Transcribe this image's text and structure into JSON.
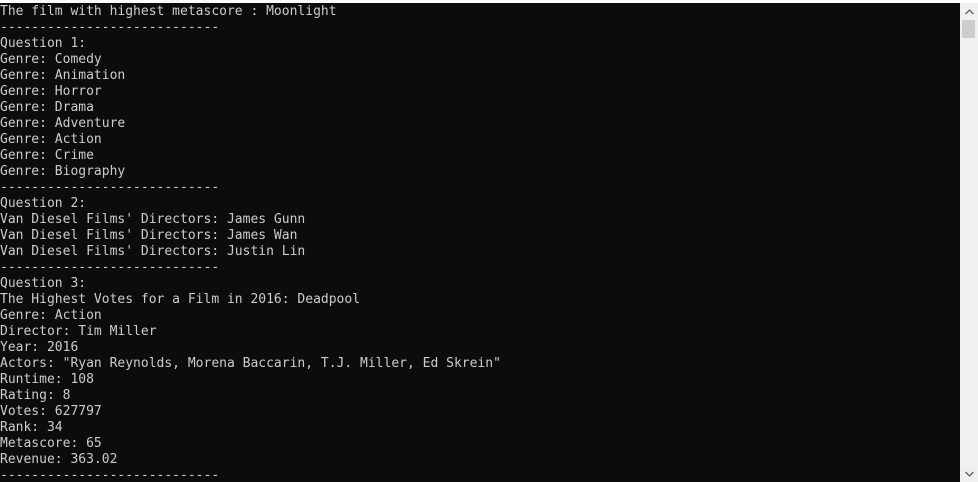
{
  "console": {
    "lines": [
      "The film with highest metascore : Moonlight",
      "----------------------------",
      "Question 1:",
      "Genre: Comedy",
      "Genre: Animation",
      "Genre: Horror",
      "Genre: Drama",
      "Genre: Adventure",
      "Genre: Action",
      "Genre: Crime",
      "Genre: Biography",
      "----------------------------",
      "Question 2:",
      "Van Diesel Films' Directors: James Gunn",
      "Van Diesel Films' Directors: James Wan",
      "Van Diesel Films' Directors: Justin Lin",
      "----------------------------",
      "Question 3:",
      "The Highest Votes for a Film in 2016: Deadpool",
      "Genre: Action",
      "Director: Tim Miller",
      "Year: 2016",
      "Actors: \"Ryan Reynolds, Morena Baccarin, T.J. Miller, Ed Skrein\"",
      "Runtime: 108",
      "Rating: 8",
      "Votes: 627797",
      "Rank: 34",
      "Metascore: 65",
      "Revenue: 363.02",
      "----------------------------"
    ]
  },
  "scrollbar": {
    "up_icon": "scroll-up-arrow-icon",
    "down_icon": "scroll-down-arrow-icon"
  }
}
